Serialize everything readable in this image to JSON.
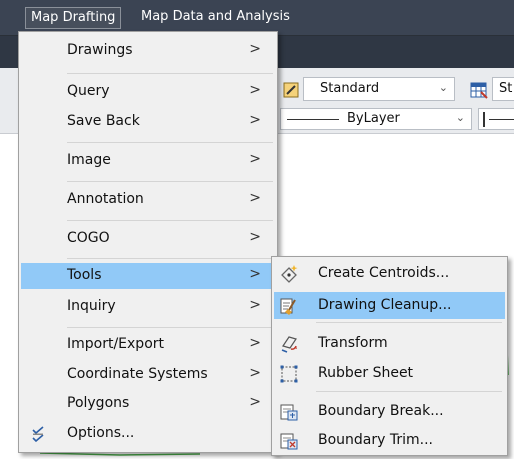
{
  "menubar": {
    "items": [
      {
        "label": "Map Drafting"
      },
      {
        "label": "Map Data and Analysis"
      }
    ]
  },
  "toolbar": {
    "style_combo": {
      "value": "Standard"
    },
    "table_style_combo": {
      "value": "St"
    },
    "linetype_combo": {
      "value": "ByLayer"
    }
  },
  "menu": {
    "items": [
      {
        "label": "Drawings"
      },
      {
        "label": "Query"
      },
      {
        "label": "Save Back"
      },
      {
        "label": "Image"
      },
      {
        "label": "Annotation"
      },
      {
        "label": "COGO"
      },
      {
        "label": "Tools"
      },
      {
        "label": "Inquiry"
      },
      {
        "label": "Import/Export"
      },
      {
        "label": "Coordinate Systems"
      },
      {
        "label": "Polygons"
      },
      {
        "label": "Options..."
      }
    ],
    "arrow_glyph": ">"
  },
  "submenu": {
    "items": [
      {
        "label": "Create Centroids..."
      },
      {
        "label": "Drawing Cleanup..."
      },
      {
        "label": "Transform"
      },
      {
        "label": "Rubber Sheet"
      },
      {
        "label": "Boundary Break..."
      },
      {
        "label": "Boundary Trim..."
      }
    ]
  },
  "colors": {
    "menubar_bg": "#3b4453",
    "highlight": "#91c9f7",
    "menu_bg": "#f0f0f0"
  },
  "icons": {
    "combo_arrow": "chevron-down-icon",
    "submenu_arrow": "chevron-right-icon"
  }
}
